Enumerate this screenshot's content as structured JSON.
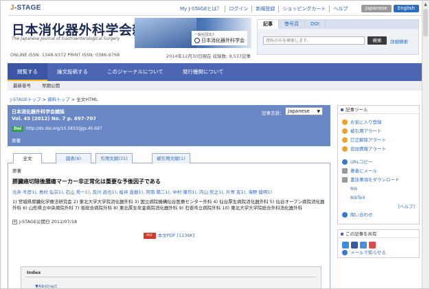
{
  "topbar": {
    "logo_prefix": "J",
    "logo_rest": "-STAGE",
    "links": [
      "My J-STAGEとは？",
      "ログイン",
      "新規登録",
      "ショッピングカート",
      "ヘルプ"
    ],
    "lang_ja": "Japanese",
    "lang_en": "English"
  },
  "journal": {
    "title": "日本消化器外科学会雑誌",
    "subtitle": "The Japanese Journal of Gastroenterological Surgery",
    "issn": "ONLINE ISSN: 1348-9372   PRINT ISSN: 0386-9768",
    "date": "2014年12月30日現在  収録数: 9,537記事",
    "society_small": "一般社団法人",
    "society": "日本消化器外科学会"
  },
  "search": {
    "tabs": [
      "記事",
      "巻号頁",
      "DOI"
    ],
    "placeholder": "資料の中を検索します。",
    "button": "検索",
    "advanced": "詳細検索"
  },
  "nav": {
    "items": [
      "閲覧する",
      "論文投稿する",
      "このジャーナルについて",
      "発行機関について"
    ]
  },
  "subnav": {
    "items": [
      "最新巻号",
      "早期公開"
    ]
  },
  "breadcrumb": {
    "top": "J-STAGEトップ",
    "sep1": " > ",
    "materials": "資料トップ",
    "sep2": " > ",
    "current": "全文HTML"
  },
  "article": {
    "journal": "日本消化器外科学会雑誌",
    "volume": "Vol. 45 (2012) No. 7 p. 697-707",
    "doi_badge": "Doi",
    "doi": "http://dx.doi.org/10.5833/jjgs.45.697",
    "kind": "原著",
    "language_label": "記事言語：",
    "language_value": "Japanese",
    "tabs": [
      "全文",
      "図表(6)",
      "引用文献(31)",
      "被引用文献(1)"
    ],
    "kind2": "原著",
    "title": "膵臓癌切除後腫瘍マーカー非正常化は重要な予後因子である",
    "authors": "元井 冬彦1), 島村 弘宗1), 石山 秀一1), 及川 昌也1), 桜井 直樹1), 阿南 陽二1), 中村 隆司1), 内山 哲之1), 片寄 友1), 海野 倫明1)",
    "affiliations": "1) 宮城県膵臓化学療法研究会 2) 東北大学大学院消化器外科 3) 国立病院機構仙台医療センター外科 4) 仙台厚生病院消化器外科 5) 仙台オープン病院消化器外科 6) 山形県立中央病院外科 7) 坂総合病院外科 8) 東北厚生年金病院消化器外科 9) 石巻市立病院外科 10) 東北大学大学院総合外科消化器外科",
    "pub_label": "J-STAGE公開日 2012/07/18",
    "pdf_icon": "PDF",
    "pdf_link": "本文PDF [1136K]",
    "index_title": "Index",
    "index_item": "▼Abstract"
  },
  "sidebar": {
    "tools_header": "記事ツール",
    "tools": [
      "お気に入り登録",
      "被引用アラート",
      "訂正解除アラート",
      "追加情報アラート"
    ],
    "links": [
      "URLコピー",
      "著者にメール",
      "書誌事項をダウンロード",
      "RIS",
      "BibTeX"
    ],
    "help": "[ヘルプ]",
    "qa": "問い合わせ",
    "share_header": "この記事を共有",
    "share_mail": "メールで知らせる"
  }
}
